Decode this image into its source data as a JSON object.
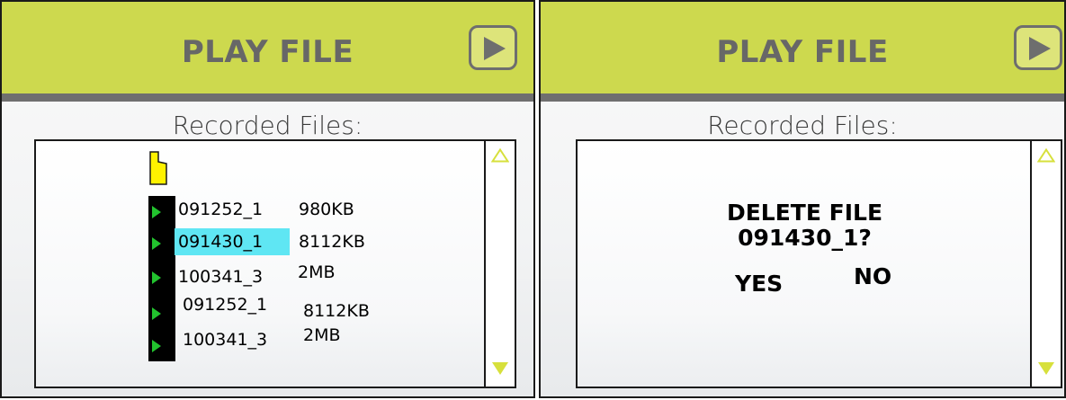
{
  "left_screen": {
    "header": {
      "title": "PLAY FILE",
      "icon": "play-icon"
    },
    "section_label": "Recorded Files:",
    "folder_icon": "folder-icon",
    "files": [
      {
        "name": "091252_1",
        "size": "980KB",
        "selected": false
      },
      {
        "name": "091430_1",
        "size": "8112KB",
        "selected": true
      },
      {
        "name": "100341_3",
        "size": "2MB",
        "selected": false
      },
      {
        "name": "091252_1",
        "size": "8112KB",
        "selected": false
      },
      {
        "name": "100341_3",
        "size": "2MB",
        "selected": false
      }
    ],
    "scroll_up_icon": "triangle-up-icon",
    "scroll_down_icon": "triangle-down-icon"
  },
  "right_screen": {
    "header": {
      "title": "PLAY FILE",
      "icon": "play-icon"
    },
    "section_label": "Recorded Files:",
    "dialog": {
      "title": "DELETE FILE",
      "file": "091430_1?",
      "yes_label": "YES",
      "no_label": "NO"
    },
    "scroll_up_icon": "triangle-up-icon",
    "scroll_down_icon": "triangle-down-icon"
  },
  "colors": {
    "header_bg": "#cdd94e",
    "header_text": "#676767",
    "header_rule": "#6f6f6f",
    "selection": "#5fe6f3",
    "row_arrow": "#22c32e",
    "scroll_arrow": "#d7e03c",
    "folder": "#fff200"
  }
}
